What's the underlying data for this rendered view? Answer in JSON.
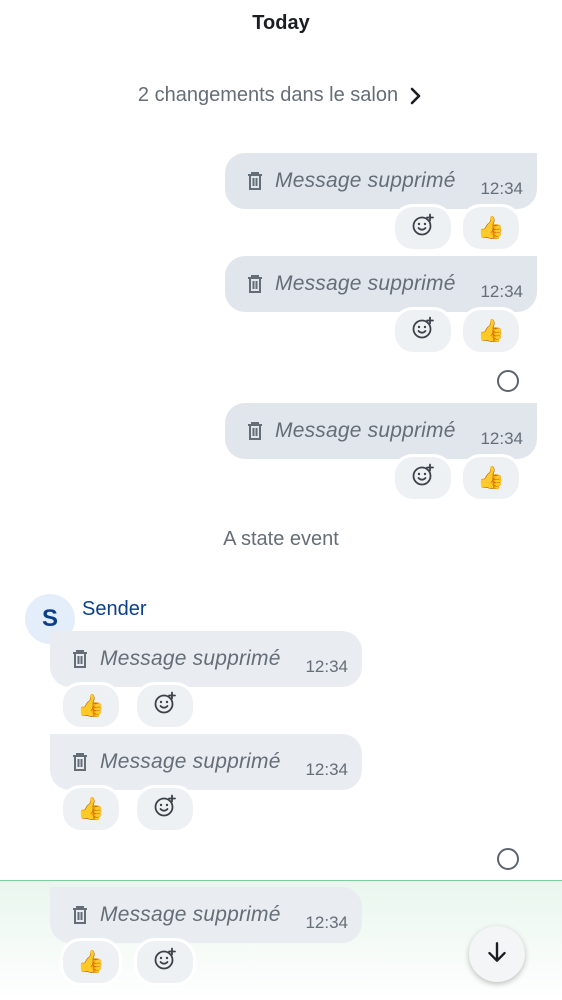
{
  "timeline": {
    "day_header": "Today",
    "room_changes": "2 changements dans le salon",
    "state_event": "A state event",
    "sender": {
      "name": "Sender",
      "initial": "S"
    },
    "messages": [
      {
        "text": "Message supprimé",
        "time": "12:34",
        "reaction": "👍"
      },
      {
        "text": "Message supprimé",
        "time": "12:34",
        "reaction": "👍"
      },
      {
        "text": "Message supprimé",
        "time": "12:34",
        "reaction": "👍"
      },
      {
        "text": "Message supprimé",
        "time": "12:34",
        "reaction": "👍"
      },
      {
        "text": "Message supprimé",
        "time": "12:34",
        "reaction": "👍"
      },
      {
        "text": "Message supprimé",
        "time": "12:34",
        "reaction": "👍"
      }
    ]
  },
  "icons": {
    "deleted": "trash-icon",
    "add_reaction": "add-reaction-icon",
    "chevron": "chevron-right-icon",
    "read_receipt": "receipt-circle-icon",
    "scroll_down": "arrow-down-icon"
  },
  "colors": {
    "outgoing_bubble": "#e1e6ec",
    "incoming_bubble": "#e9ecf0",
    "sender_name": "#0b3f8a",
    "highlight_border": "#7fcf9e"
  }
}
